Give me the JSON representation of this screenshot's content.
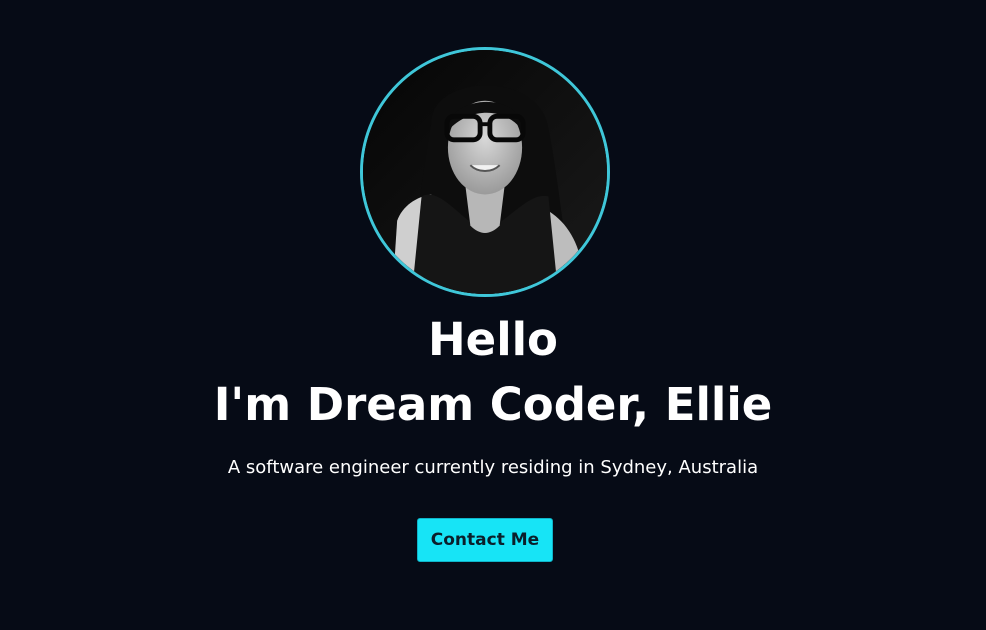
{
  "hero": {
    "avatar": {
      "alt": "Ellie portrait (black & white)"
    },
    "greeting": "Hello",
    "headline": "I'm Dream Coder, Ellie",
    "tagline": "A software engineer currently residing in Sydney, Australia",
    "contact_label": "Contact Me"
  },
  "colors": {
    "background": "#060b16",
    "accent": "#17e4f6",
    "ring": "#3fc7d9",
    "text": "#ffffff"
  }
}
